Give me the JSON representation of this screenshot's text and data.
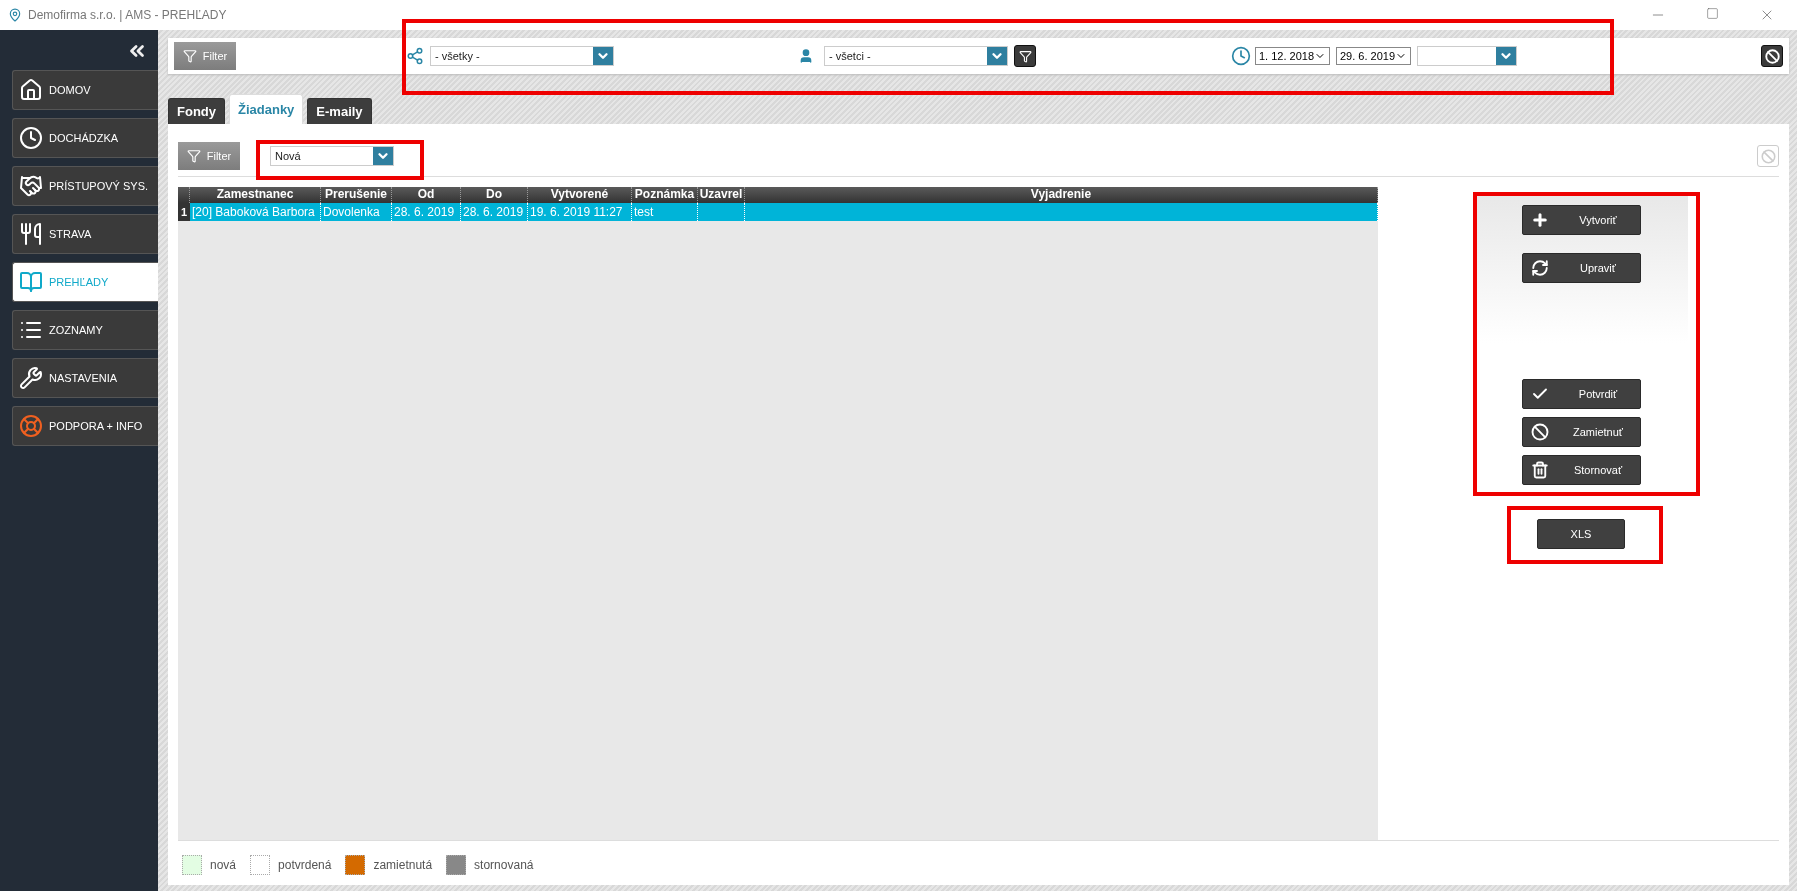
{
  "window": {
    "title": "Demofirma s.r.o. | AMS - PREHĽADY"
  },
  "sidebar": {
    "items": [
      {
        "label": "DOMOV",
        "kind": "home",
        "selected": false
      },
      {
        "label": "DOCHÁDZKA",
        "kind": "clock",
        "selected": false
      },
      {
        "label": "PRÍSTUPOVÝ SYS.",
        "kind": "handshake",
        "selected": false
      },
      {
        "label": "STRAVA",
        "kind": "meal",
        "selected": false
      },
      {
        "label": "PREHĽADY",
        "kind": "overview",
        "selected": true
      },
      {
        "label": "ZOZNAMY",
        "kind": "list",
        "selected": false
      },
      {
        "label": "NASTAVENIA",
        "kind": "tools",
        "selected": false
      },
      {
        "label": "PODPORA + INFO",
        "kind": "support",
        "selected": false
      }
    ]
  },
  "top_filter": {
    "filter_button": "Filter",
    "group_select": "- všetky -",
    "person_select": "- všetci -",
    "date_from": "1. 12. 2018",
    "date_to": "29. 6. 2019"
  },
  "tabs": [
    {
      "label": "Fondy",
      "selected": false
    },
    {
      "label": "Žiadanky",
      "selected": true
    },
    {
      "label": "E-maily",
      "selected": false
    }
  ],
  "panel": {
    "filter_button": "Filter",
    "status_select": "Nová"
  },
  "table": {
    "columns": [
      "Zamestnanec",
      "Prerušenie",
      "Od",
      "Do",
      "Vytvorené",
      "Poznámka",
      "Uzavrel",
      "Vyjadrenie"
    ],
    "rows": [
      {
        "number": "1",
        "selected": true,
        "cells": [
          "[20] Baboková Barbora",
          "Dovolenka",
          "28. 6. 2019",
          "28. 6. 2019",
          "19. 6. 2019  11:27",
          "test"
        ]
      }
    ]
  },
  "actions_top": [
    {
      "label": "Vytvoriť",
      "kind": "create"
    },
    {
      "label": "Upraviť",
      "kind": "edit"
    }
  ],
  "actions_bottom": [
    {
      "label": "Potvrdiť",
      "kind": "confirm"
    },
    {
      "label": "Zamietnuť",
      "kind": "reject"
    },
    {
      "label": "Stornovať",
      "kind": "cancel"
    }
  ],
  "export_button": "XLS",
  "legend": [
    {
      "label": "nová",
      "color": "#e3fde3"
    },
    {
      "label": "potvrdená",
      "color": "#ffffff"
    },
    {
      "label": "zamietnutá",
      "color": "#d46a00"
    },
    {
      "label": "stornovaná",
      "color": "#888888"
    }
  ]
}
